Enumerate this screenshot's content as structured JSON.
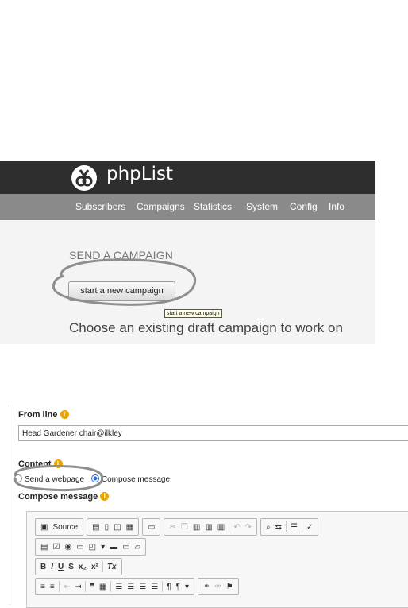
{
  "header": {
    "logo_text": "phpList"
  },
  "nav": {
    "items": [
      "Subscribers",
      "Campaigns",
      "Statistics",
      "System",
      "Config",
      "Info"
    ]
  },
  "campaign": {
    "title": "SEND A CAMPAIGN",
    "new_button": "start a new campaign",
    "tooltip": "start a new campaign",
    "choose_text": "Choose an existing draft campaign to work on"
  },
  "editor": {
    "from_label": "From line",
    "from_value": "Head Gardener chair@ilkley",
    "content_label": "Content",
    "radio_webpage": "Send a webpage",
    "radio_compose": "Compose message",
    "compose_label": "Compose message",
    "source_label": "Source",
    "info_glyph": "i",
    "accent_info": "#e8a400",
    "radio_selected": "compose"
  }
}
